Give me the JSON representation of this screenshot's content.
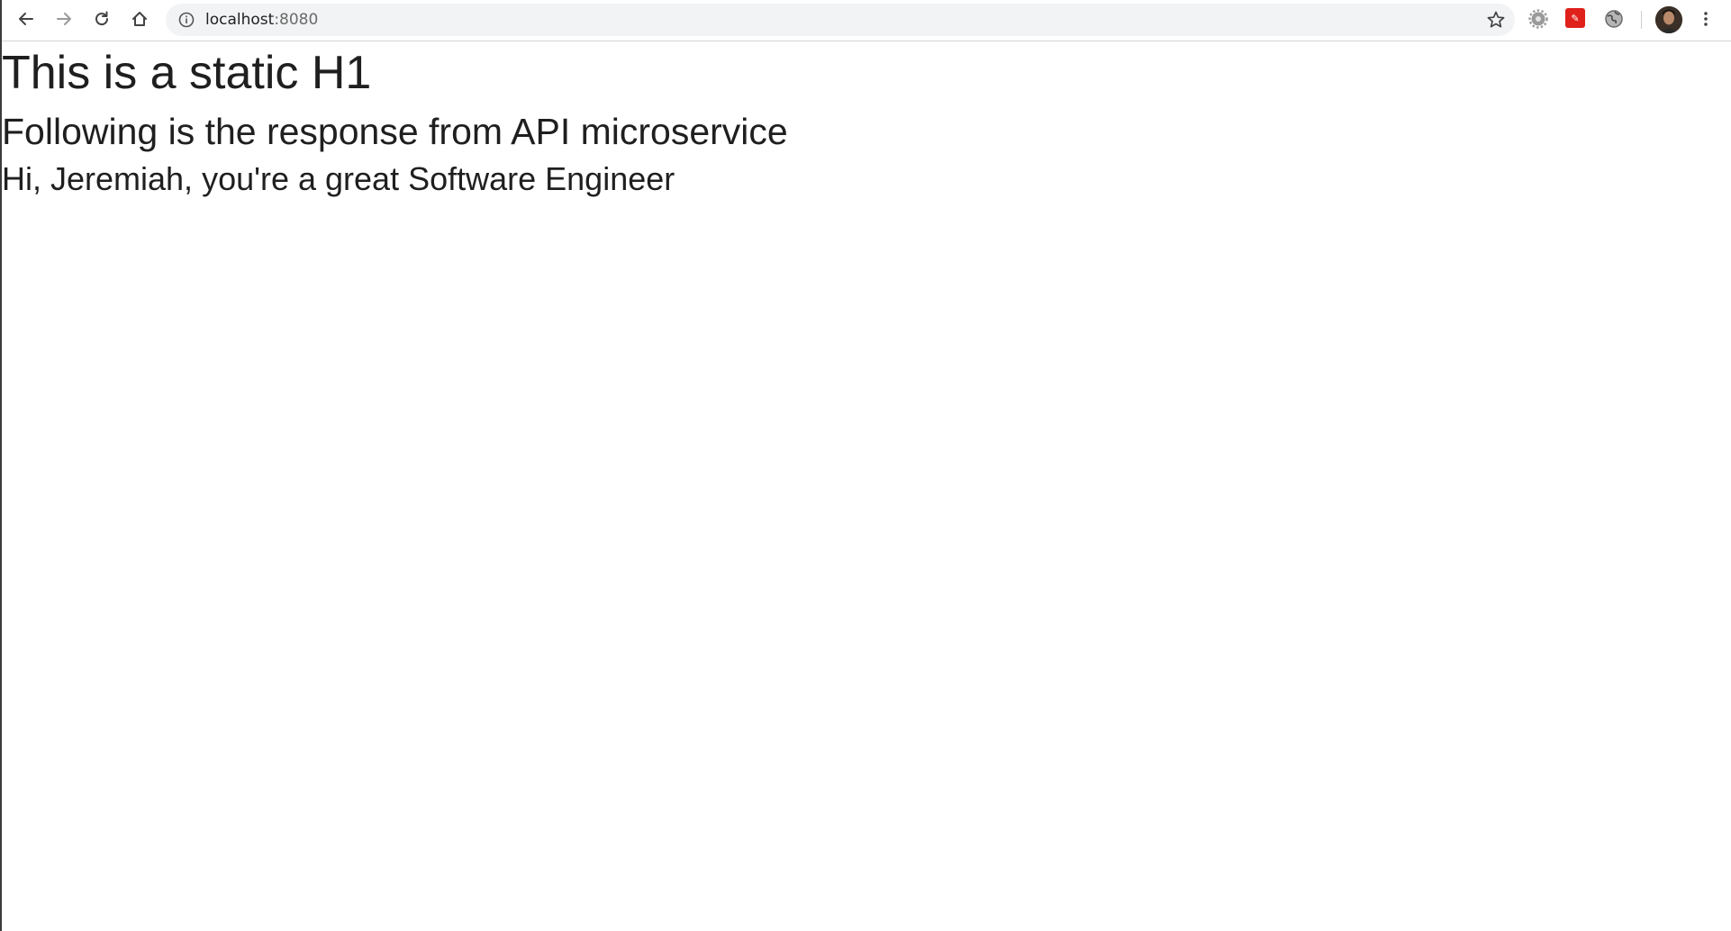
{
  "browser": {
    "url_host": "localhost",
    "url_port": ":8080",
    "icons": {
      "back": "arrow-left-icon",
      "forward": "arrow-right-icon",
      "reload": "reload-icon",
      "home": "home-icon",
      "site_info": "info-icon",
      "bookmark": "star-icon",
      "menu": "kebab-menu-icon"
    },
    "extensions": [
      "gear-extension-icon",
      "pdf-extension-icon",
      "globe-extension-icon"
    ],
    "colors": {
      "toolbar_bg": "#ffffff",
      "omnibox_bg": "#f1f3f4",
      "pdf_extension": "#e0201b"
    }
  },
  "page": {
    "heading": "This is a static H1",
    "subheading": "Following is the response from API microservice",
    "response": "Hi, Jeremiah, you're a great Software Engineer"
  }
}
